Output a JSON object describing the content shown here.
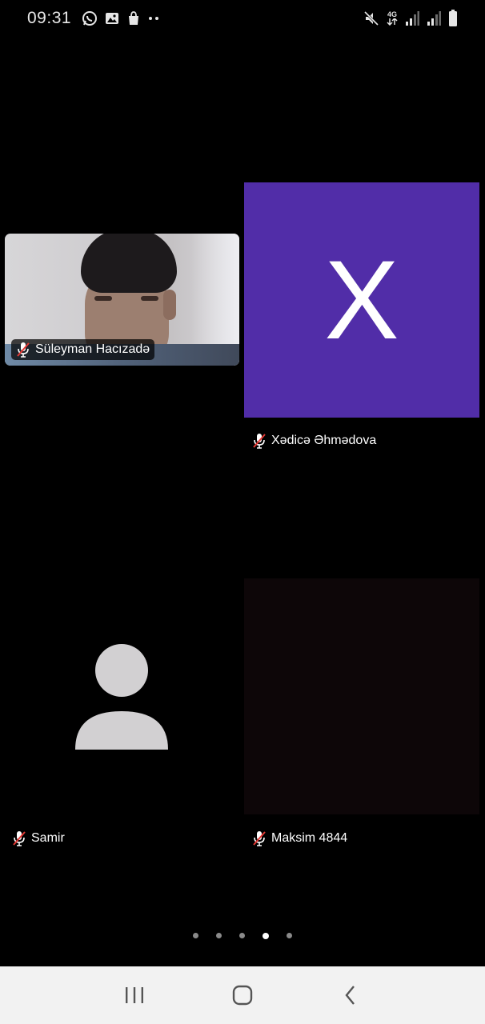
{
  "status_bar": {
    "time": "09:31",
    "notification_icons": [
      "whatsapp-icon",
      "gallery-icon",
      "shopping-bag-icon",
      "more-dots-icon"
    ],
    "right_icons": [
      "mute-icon",
      "network-4g-icon",
      "signal-icon",
      "signal-icon-2",
      "battery-icon"
    ],
    "network_label": "4G"
  },
  "participants": [
    {
      "name": "Süleyman Hacızadə",
      "muted": true,
      "type": "video"
    },
    {
      "name": "Xədicə Əhmədova",
      "muted": true,
      "type": "initial",
      "initial": "X",
      "color": "#512da8"
    },
    {
      "name": "Samir",
      "muted": true,
      "type": "avatar"
    },
    {
      "name": "Maksim 4844",
      "muted": true,
      "type": "dark-video"
    }
  ],
  "pagination": {
    "total": 5,
    "active_index": 3
  },
  "nav_bar": {
    "buttons": [
      "recent-apps",
      "home",
      "back"
    ]
  },
  "colors": {
    "background": "#000000",
    "initial_tile": "#512da8",
    "muted_mic": "#e53935",
    "nav_bar": "#f2f2f2"
  }
}
